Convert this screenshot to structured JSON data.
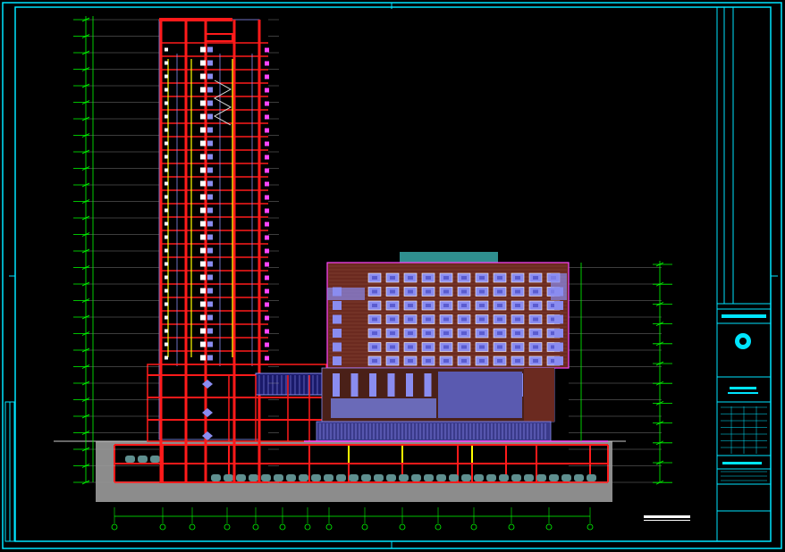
{
  "colors": {
    "background": "#000000",
    "border": "#00e5ff",
    "dimension": "#00ff00",
    "column": "#ff1a1a",
    "accent_yellow": "#ffff00",
    "glass": "#8a8cf0",
    "brick": "#7a3a2a",
    "facade": "#ff44ff",
    "ground": "#8c8c8c",
    "parking": "#00c8c8",
    "grid_bubble": "#00ff00",
    "title_white": "#ffffff"
  },
  "drawing": {
    "tower_floor_count": 24,
    "hotel_floor_count": 7,
    "window_columns": 11,
    "basement_levels": 2,
    "grid_axis_count": 15,
    "view_label": "",
    "grid_labels": []
  },
  "title_block": {
    "emblem_icon": "logo-circle-icon",
    "rows": 7
  }
}
